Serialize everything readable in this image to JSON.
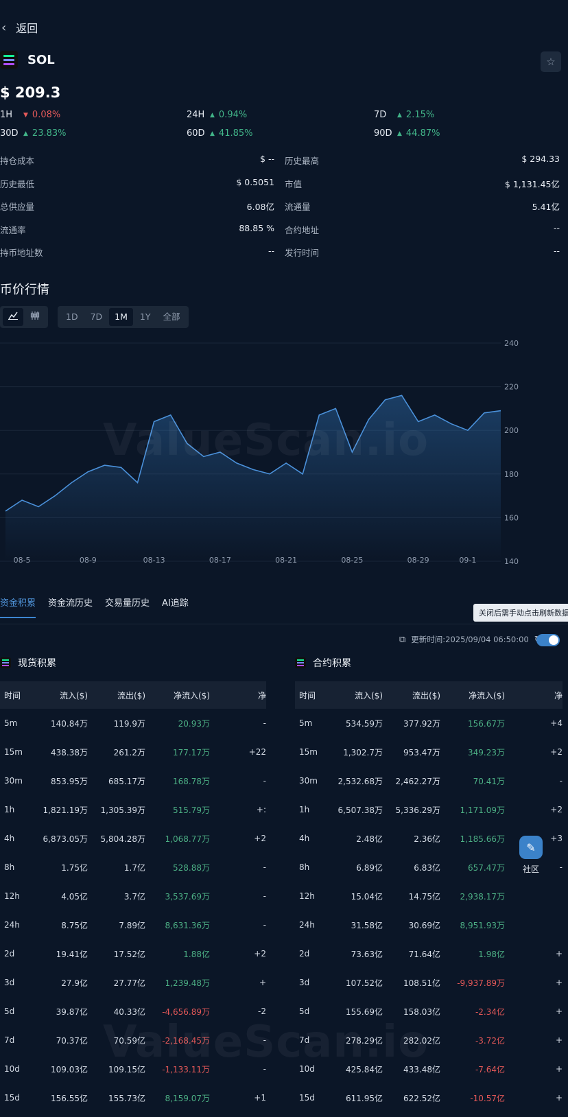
{
  "nav": {
    "back_label": "返回"
  },
  "coin": {
    "symbol": "SOL",
    "price": "$ 209.3"
  },
  "changes": [
    {
      "label": "1H",
      "value": "0.08%",
      "dir": "down"
    },
    {
      "label": "24H",
      "value": "0.94%",
      "dir": "up"
    },
    {
      "label": "7D",
      "value": "2.15%",
      "dir": "up"
    },
    {
      "label": "30D",
      "value": "23.83%",
      "dir": "up"
    },
    {
      "label": "60D",
      "value": "41.85%",
      "dir": "up"
    },
    {
      "label": "90D",
      "value": "44.87%",
      "dir": "up"
    }
  ],
  "stats": [
    {
      "label": "持仓成本",
      "value": "$ --"
    },
    {
      "label": "历史最高",
      "value": "$ 294.33"
    },
    {
      "label": "历史最低",
      "value": "$ 0.5051"
    },
    {
      "label": "市值",
      "value": "$ 1,131.45亿"
    },
    {
      "label": "总供应量",
      "value": "6.08亿"
    },
    {
      "label": "流通量",
      "value": "5.41亿"
    },
    {
      "label": "流通率",
      "value": "88.85 %"
    },
    {
      "label": "合约地址",
      "value": "--"
    },
    {
      "label": "持币地址数",
      "value": "--"
    },
    {
      "label": "发行时间",
      "value": "--"
    }
  ],
  "chart_section": {
    "title": "币价行情",
    "chart_types": [
      "line-chart-icon",
      "candlestick-icon"
    ],
    "ranges": [
      "1D",
      "7D",
      "1M",
      "1Y",
      "全部"
    ],
    "active_range": "1M",
    "watermark": "ValueScan.io"
  },
  "chart_data": {
    "type": "area",
    "ylim": [
      140,
      240
    ],
    "yticks": [
      240,
      220,
      200,
      180,
      160,
      140
    ],
    "xlim": [
      "08-04",
      "09-03"
    ],
    "xticks": [
      "08-5",
      "08-9",
      "08-13",
      "08-17",
      "08-21",
      "08-25",
      "08-29",
      "09-1"
    ],
    "x": [
      "08-04",
      "08-05",
      "08-06",
      "08-07",
      "08-08",
      "08-09",
      "08-10",
      "08-11",
      "08-12",
      "08-13",
      "08-14",
      "08-15",
      "08-16",
      "08-17",
      "08-18",
      "08-19",
      "08-20",
      "08-21",
      "08-22",
      "08-23",
      "08-24",
      "08-25",
      "08-26",
      "08-27",
      "08-28",
      "08-29",
      "08-30",
      "08-31",
      "09-01",
      "09-02",
      "09-03"
    ],
    "values": [
      163,
      168,
      165,
      170,
      176,
      181,
      184,
      183,
      176,
      204,
      207,
      194,
      188,
      190,
      185,
      182,
      180,
      185,
      180,
      207,
      210,
      190,
      205,
      214,
      216,
      204,
      207,
      203,
      200,
      208,
      209
    ],
    "grid": true,
    "color": "#4a90d9"
  },
  "tabs": [
    "资金积累",
    "资金流历史",
    "交易量历史",
    "AI追踪"
  ],
  "active_tab": "资金积累",
  "tooltip": "关闭后需手动点击刷新数据",
  "update_time": "更新时间:2025/09/04 06:50:00",
  "spot": {
    "title": "现货积累",
    "headers": [
      "时间",
      "流入($)",
      "流出($)",
      "净流入($)",
      "净"
    ],
    "rows": [
      [
        "5m",
        "140.84万",
        "119.9万",
        "20.93万",
        "-"
      ],
      [
        "15m",
        "438.38万",
        "261.2万",
        "177.17万",
        "+22"
      ],
      [
        "30m",
        "853.95万",
        "685.17万",
        "168.78万",
        "-"
      ],
      [
        "1h",
        "1,821.19万",
        "1,305.39万",
        "515.79万",
        "+:"
      ],
      [
        "4h",
        "6,873.05万",
        "5,804.28万",
        "1,068.77万",
        "+2"
      ],
      [
        "8h",
        "1.75亿",
        "1.7亿",
        "528.88万",
        "-"
      ],
      [
        "12h",
        "4.05亿",
        "3.7亿",
        "3,537.69万",
        "-"
      ],
      [
        "24h",
        "8.75亿",
        "7.89亿",
        "8,631.36万",
        "-"
      ],
      [
        "2d",
        "19.41亿",
        "17.52亿",
        "1.88亿",
        "+2"
      ],
      [
        "3d",
        "27.9亿",
        "27.77亿",
        "1,239.48万",
        "+"
      ],
      [
        "5d",
        "39.87亿",
        "40.33亿",
        "-4,656.89万",
        "-2"
      ],
      [
        "7d",
        "70.37亿",
        "70.59亿",
        "-2,168.45万",
        "-"
      ],
      [
        "10d",
        "109.03亿",
        "109.15亿",
        "-1,133.11万",
        "-"
      ],
      [
        "15d",
        "156.55亿",
        "155.73亿",
        "8,159.07万",
        "+1"
      ]
    ]
  },
  "futures": {
    "title": "合约积累",
    "headers": [
      "时间",
      "流入($)",
      "流出($)",
      "净流入($)",
      "净"
    ],
    "rows": [
      [
        "5m",
        "534.59万",
        "377.92万",
        "156.67万",
        "+4"
      ],
      [
        "15m",
        "1,302.7万",
        "953.47万",
        "349.23万",
        "+2"
      ],
      [
        "30m",
        "2,532.68万",
        "2,462.27万",
        "70.41万",
        "-"
      ],
      [
        "1h",
        "6,507.38万",
        "5,336.29万",
        "1,171.09万",
        "+2"
      ],
      [
        "4h",
        "2.48亿",
        "2.36亿",
        "1,185.66万",
        "+3"
      ],
      [
        "8h",
        "6.89亿",
        "6.83亿",
        "657.47万",
        "-"
      ],
      [
        "12h",
        "15.04亿",
        "14.75亿",
        "2,938.17万",
        ""
      ],
      [
        "24h",
        "31.58亿",
        "30.69亿",
        "8,951.93万",
        ""
      ],
      [
        "2d",
        "73.63亿",
        "71.64亿",
        "1.98亿",
        "+"
      ],
      [
        "3d",
        "107.52亿",
        "108.51亿",
        "-9,937.89万",
        "+"
      ],
      [
        "5d",
        "155.69亿",
        "158.03亿",
        "-2.34亿",
        "+"
      ],
      [
        "7d",
        "278.29亿",
        "282.02亿",
        "-3.72亿",
        "+"
      ],
      [
        "10d",
        "425.84亿",
        "433.48亿",
        "-7.64亿",
        "+"
      ],
      [
        "15d",
        "611.95亿",
        "622.52亿",
        "-10.57亿",
        "+"
      ]
    ]
  },
  "community_label": "社区"
}
